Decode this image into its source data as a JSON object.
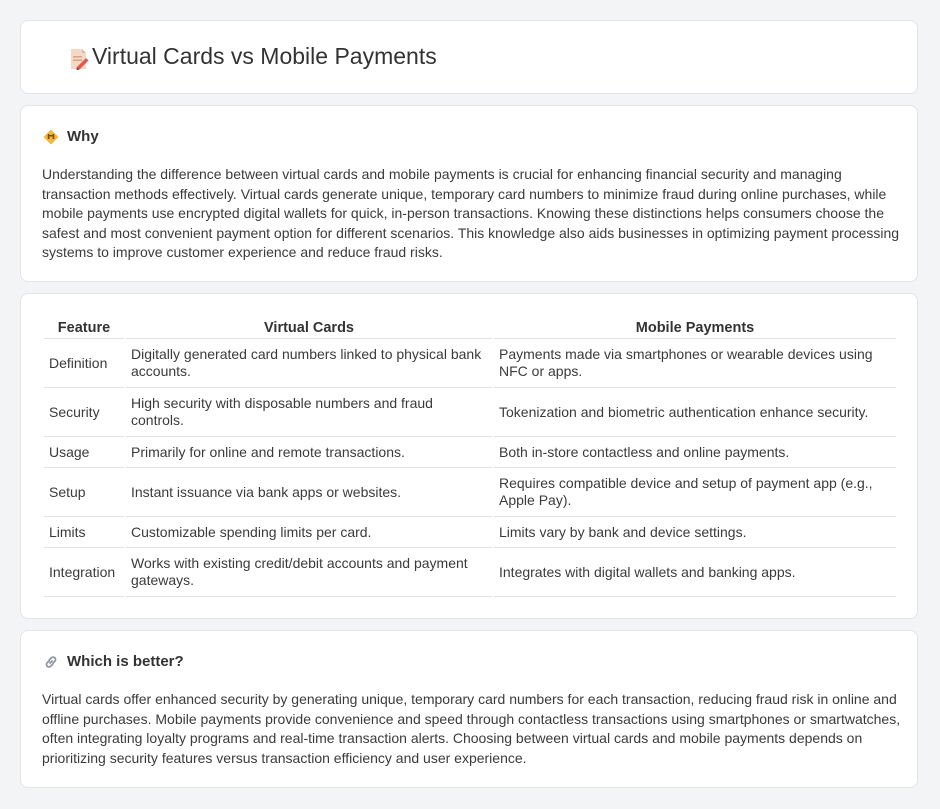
{
  "page": {
    "title": "Virtual Cards vs Mobile Payments"
  },
  "why": {
    "heading": "Why",
    "text": "Understanding the difference between virtual cards and mobile payments is crucial for enhancing financial security and managing transaction methods effectively. Virtual cards generate unique, temporary card numbers to minimize fraud during online purchases, while mobile payments use encrypted digital wallets for quick, in-person transactions. Knowing these distinctions helps consumers choose the safest and most convenient payment option for different scenarios. This knowledge also aids businesses in optimizing payment processing systems to improve customer experience and reduce fraud risks."
  },
  "table": {
    "headers": [
      "Feature",
      "Virtual Cards",
      "Mobile Payments"
    ],
    "rows": [
      [
        "Definition",
        "Digitally generated card numbers linked to physical bank accounts.",
        "Payments made via smartphones or wearable devices using NFC or apps."
      ],
      [
        "Security",
        "High security with disposable numbers and fraud controls.",
        "Tokenization and biometric authentication enhance security."
      ],
      [
        "Usage",
        "Primarily for online and remote transactions.",
        "Both in-store contactless and online payments."
      ],
      [
        "Setup",
        "Instant issuance via bank apps or websites.",
        "Requires compatible device and setup of payment app (e.g., Apple Pay)."
      ],
      [
        "Limits",
        "Customizable spending limits per card.",
        "Limits vary by bank and device settings."
      ],
      [
        "Integration",
        "Works with existing credit/debit accounts and payment gateways.",
        "Integrates with digital wallets and banking apps."
      ]
    ]
  },
  "better": {
    "heading": "Which is better?",
    "text": "Virtual cards offer enhanced security by generating unique, temporary card numbers for each transaction, reducing fraud risk in online and offline purchases. Mobile payments provide convenience and speed through contactless transactions using smartphones or smartwatches, often integrating loyalty programs and real-time transaction alerts. Choosing between virtual cards and mobile payments depends on prioritizing security features versus transaction efficiency and user experience."
  }
}
